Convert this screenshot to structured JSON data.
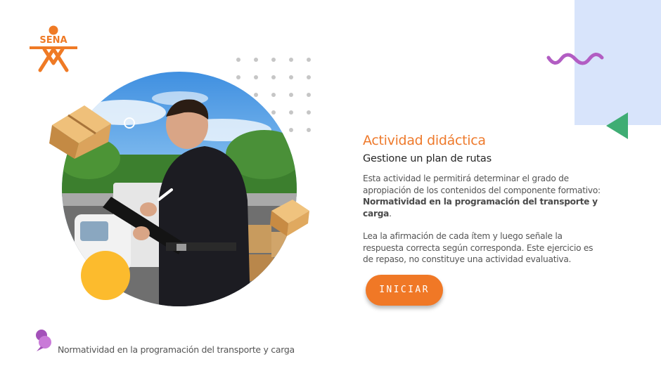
{
  "brand": {
    "logo_text": "SENA",
    "color": "#ef7a25"
  },
  "activity": {
    "title": "Actividad didáctica",
    "subtitle": "Gestione un plan de rutas",
    "description_intro": "Esta actividad le permitirá determinar el grado de apropiación de los contenidos del componente formativo:",
    "description_bold": "Normatividad en la programación del transporte y carga",
    "description_end": ".",
    "instructions": "Lea la afirmación de cada ítem y luego señale la respuesta correcta según corresponda.  Este ejercicio es de repaso, no constituye una actividad evaluativa."
  },
  "start_button": {
    "label": "INICIAR"
  },
  "footer": {
    "icon": "pin-icon",
    "text": "Normatividad en la programación del transporte y carga"
  },
  "colors": {
    "accent_orange": "#ef7a25",
    "panel_blue": "#d8e4fb",
    "triangle_green": "#3fad74",
    "squiggle_purple": "#b25dc3",
    "circle_yellow": "#fcbb2d"
  }
}
